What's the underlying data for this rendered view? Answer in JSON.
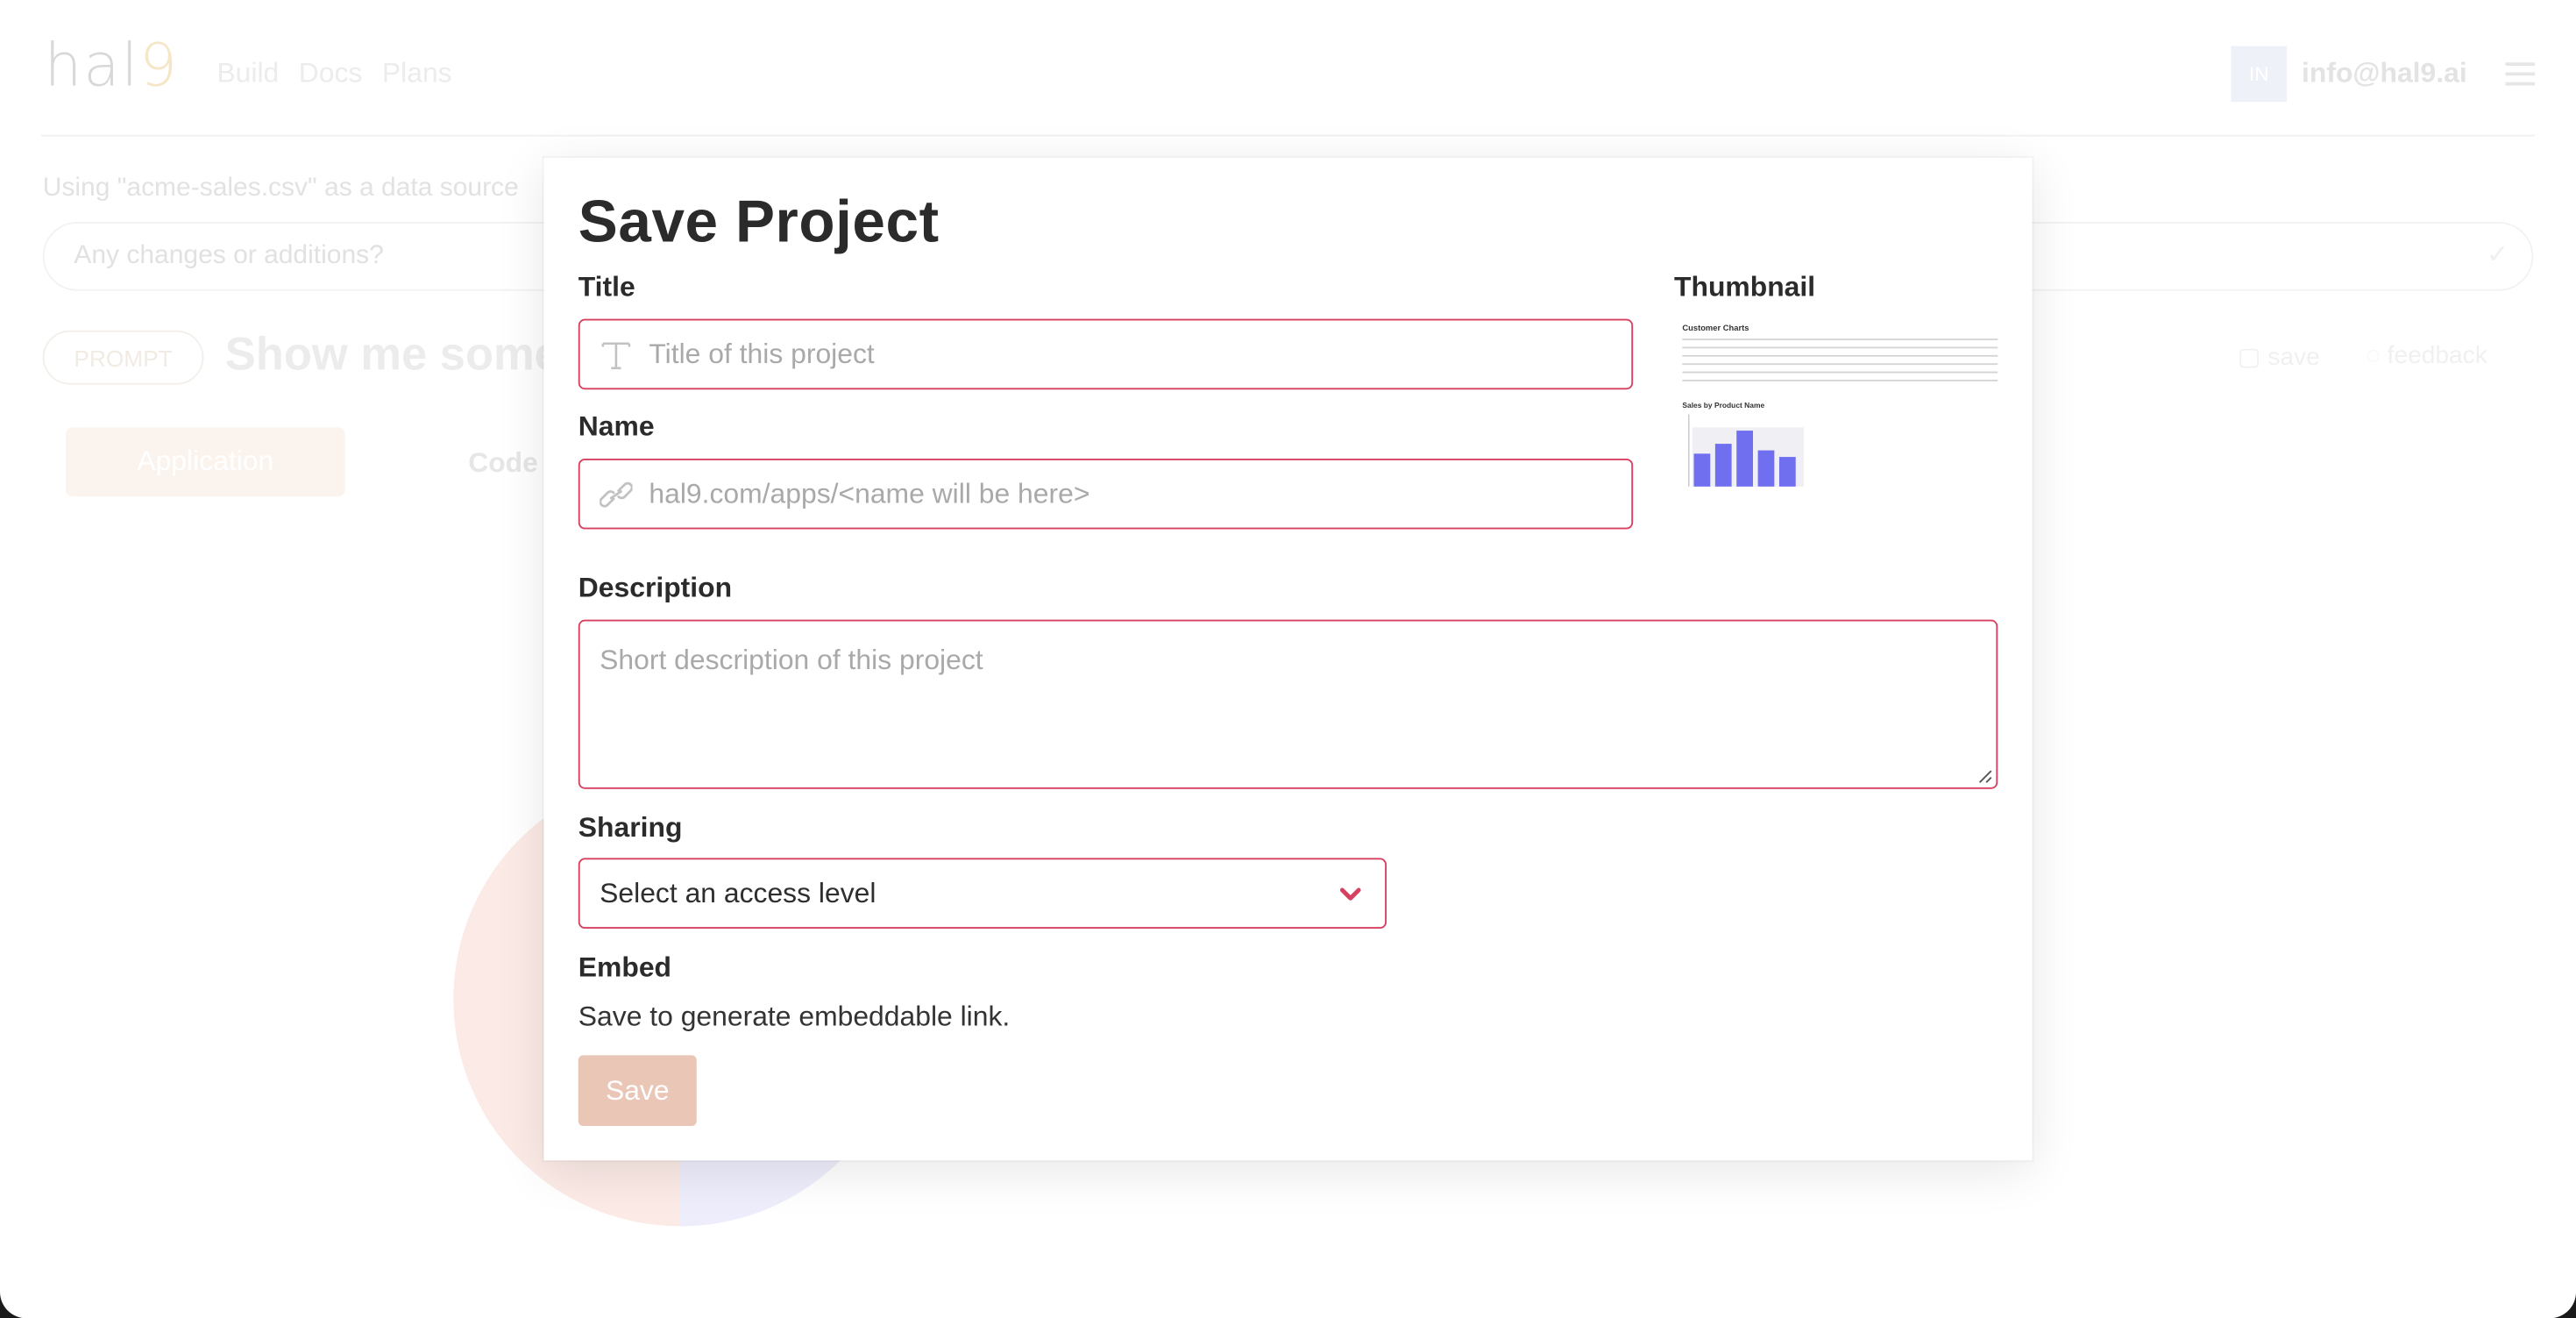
{
  "app": {
    "logo": "hal",
    "logo_mark": "9",
    "nav": [
      "Build",
      "Docs",
      "Plans"
    ],
    "user_initials": "IN",
    "user_email": "info@hal9.ai",
    "data_source_note": "Using \"acme-sales.csv\" as a data source",
    "prompt_placeholder": "Any changes or additions?",
    "prompt_badge": "PROMPT",
    "prompt_text": "Show me some",
    "save_link": "save",
    "feedback_link": "feedback",
    "tabs": [
      "Application",
      "Code"
    ]
  },
  "modal": {
    "title": "Save Project",
    "title_field": {
      "label": "Title",
      "placeholder": "Title of this project",
      "value": ""
    },
    "name_field": {
      "label": "Name",
      "placeholder": "hal9.com/apps/<name will be here>",
      "value": ""
    },
    "description_field": {
      "label": "Description",
      "placeholder": "Short description of this project",
      "value": ""
    },
    "sharing": {
      "label": "Sharing",
      "selected": "Select an access level"
    },
    "embed": {
      "label": "Embed",
      "text": "Save to generate embeddable link."
    },
    "save_button": "Save",
    "thumbnail": {
      "label": "Thumbnail",
      "heading_1": "Customer Charts",
      "heading_2": "Sales by Product Name"
    }
  },
  "colors": {
    "field_border": "#d7415f",
    "save_button_bg": "#e9c6b5",
    "thumbnail_bars": "#6f6ff0"
  }
}
